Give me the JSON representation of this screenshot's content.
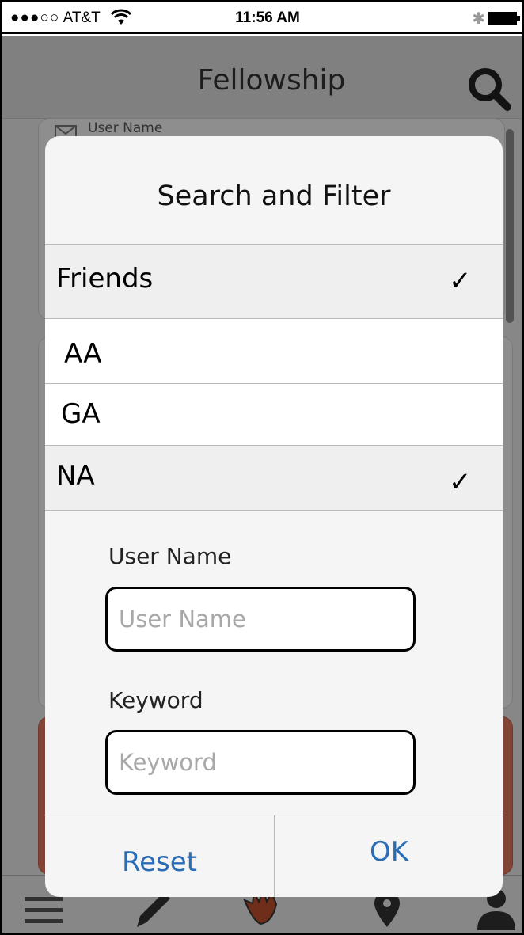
{
  "status_bar": {
    "signal": "●●●○○",
    "carrier": "AT&T",
    "time": "11:56 AM",
    "bluetooth": "bluetooth-icon",
    "battery": "battery-icon"
  },
  "nav": {
    "title": "Fellowship",
    "search_icon": "search-icon"
  },
  "background_card": {
    "user_name": "User Name"
  },
  "tab_bar": {
    "icons": [
      "menu-icon",
      "pencil-icon",
      "hand-icon",
      "location-pin-icon",
      "person-icon"
    ]
  },
  "modal": {
    "title": "Search and Filter",
    "filters": [
      {
        "label": "Friends",
        "checked": true,
        "check": "✓"
      },
      {
        "label": "AA",
        "checked": false,
        "check": ""
      },
      {
        "label": "GA",
        "checked": false,
        "check": ""
      },
      {
        "label": "NA",
        "checked": true,
        "check": "✓"
      }
    ],
    "user_name_label": "User Name",
    "user_name_placeholder": "User Name",
    "user_name_value": "",
    "keyword_label": "Keyword",
    "keyword_placeholder": "Keyword",
    "keyword_value": "",
    "reset_label": "Reset",
    "ok_label": "OK"
  },
  "colors": {
    "accent": "#2a6db5",
    "card_highlight": "#e07560"
  }
}
